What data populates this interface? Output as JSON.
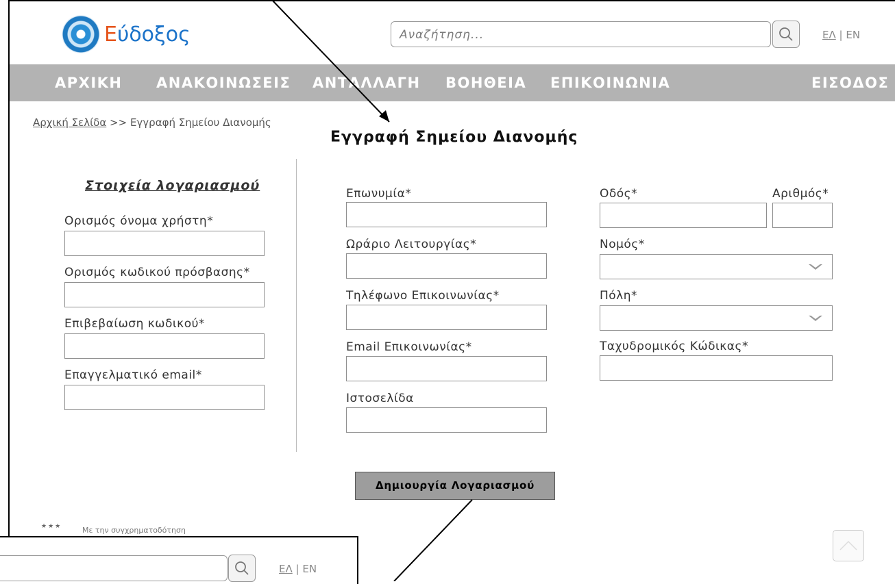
{
  "header": {
    "logo_text_first": "Ε",
    "logo_text_rest": "ύδοξος",
    "search_placeholder": "Αναζήτηση...",
    "lang_el": "ΕΛ",
    "lang_sep": " | ",
    "lang_en": "EN"
  },
  "nav": {
    "home": "ΑΡΧΙΚΗ",
    "announcements": "ΑΝΑΚΟΙΝΩΣΕΙΣ",
    "exchange": "ΑΝΤΑΛΛΑΓΗ",
    "help": "ΒΟΗΘΕΙΑ",
    "contact": "ΕΠΙΚΟΙΝΩΝΙΑ",
    "login": "ΕΙΣΟΔΟΣ"
  },
  "breadcrumb": {
    "home_link": "Αρχική Σελίδα",
    "separator": " >> ",
    "current": "Εγγραφή Σημείου Διανομής"
  },
  "page_title": "Εγγραφή Σημείου Διανομής",
  "account": {
    "section_title": "Στοιχεία λογαριασμού",
    "username_label": "Ορισμός όνομα χρήστη*",
    "password_label": "Ορισμός κωδικού πρόσβασης*",
    "confirm_label": "Επιβεβαίωση κωδικού*",
    "email_label": "Επαγγελματικό email*"
  },
  "business": {
    "name_label": "Επωνυμία*",
    "hours_label": "Ωράριο Λειτουργίας*",
    "phone_label": "Τηλέφωνο Επικοινωνίας*",
    "email_label": "Email Επικοινωνίας*",
    "website_label": "Ιστοσελίδα"
  },
  "address": {
    "street_label": "Οδός*",
    "number_label": "Αριθμός*",
    "prefecture_label": "Νομός*",
    "city_label": "Πόλη*",
    "postal_label": "Ταχυδρομικός Κώδικας*"
  },
  "create_button": "Δημιουργία Λογαριασμού",
  "footer": {
    "eu_stars": "★★★",
    "eu_text": "Με την συγχρηματοδότηση"
  },
  "icons": {
    "search": "magnifier-icon",
    "scroll_top": "chevron-up-icon",
    "select": "chevron-down-icon"
  }
}
